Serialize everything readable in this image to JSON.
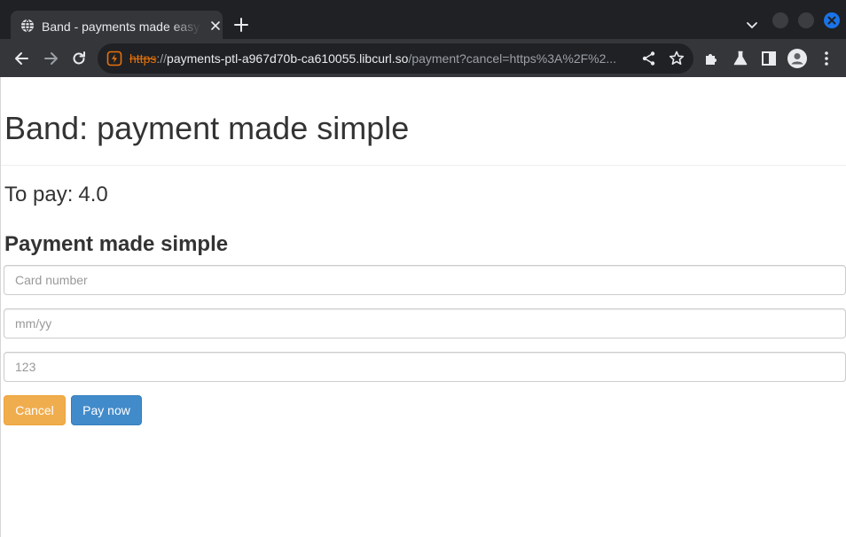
{
  "browser": {
    "tab": {
      "title": "Band - payments made easy"
    },
    "address_bar": {
      "scheme": "https",
      "separator": "://",
      "host": "payments-ptl-a967d70b-ca610055.libcurl.so",
      "path": "/payment?cancel=https%3A%2F%2..."
    }
  },
  "page": {
    "title": "Band: payment made simple",
    "amount_label": "To pay:",
    "amount_value": "4.0",
    "form_heading": "Payment made simple",
    "fields": {
      "card_number_placeholder": "Card number",
      "expiry_placeholder": "mm/yy",
      "cvc_placeholder": "123"
    },
    "buttons": {
      "cancel": "Cancel",
      "pay": "Pay now"
    }
  },
  "colors": {
    "cancel_button": "#f0ad4e",
    "pay_button": "#428bca",
    "insecure_scheme": "#e8710a",
    "window_close": "#1a73e8"
  }
}
